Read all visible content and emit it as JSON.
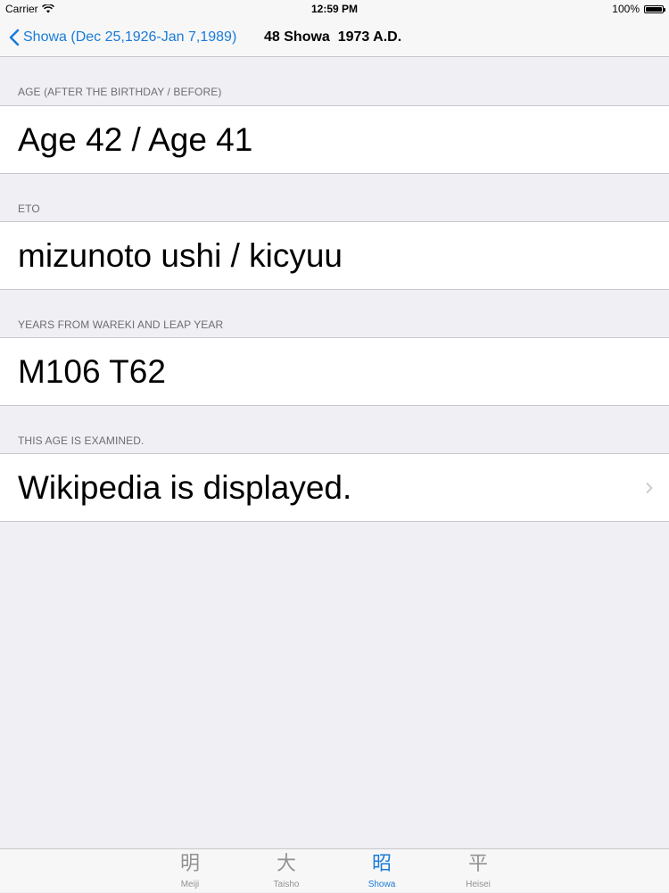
{
  "status_bar": {
    "carrier": "Carrier",
    "time": "12:59 PM",
    "battery": "100%"
  },
  "nav": {
    "back_label": "Showa (Dec 25,1926-Jan 7,1989)",
    "title": "48 Showa  1973 A.D."
  },
  "sections": [
    {
      "header": "AGE (AFTER THE BIRTHDAY / BEFORE)",
      "value": "Age 42 / Age 41"
    },
    {
      "header": "ETO",
      "value": "mizunoto ushi / kicyuu"
    },
    {
      "header": "YEARS FROM WAREKI AND LEAP YEAR",
      "value": "M106 T62"
    },
    {
      "header": "THIS AGE IS EXAMINED.",
      "value": "Wikipedia is displayed."
    }
  ],
  "tabs": [
    {
      "glyph": "明",
      "label": "Meiji"
    },
    {
      "glyph": "大",
      "label": "Taisho"
    },
    {
      "glyph": "昭",
      "label": "Showa"
    },
    {
      "glyph": "平",
      "label": "Heisei"
    }
  ],
  "colors": {
    "accent": "#1a7bd9",
    "background": "#efeff4",
    "inactive_tab": "#929292"
  }
}
